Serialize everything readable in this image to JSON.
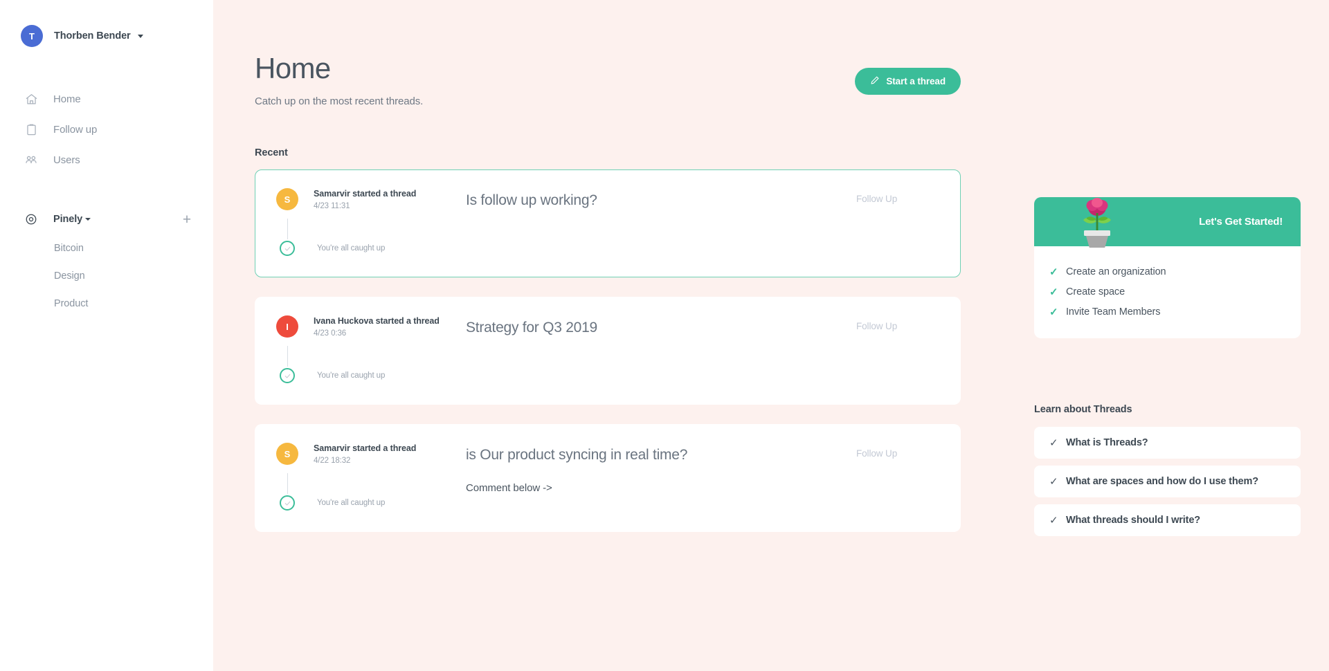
{
  "sidebar": {
    "user": {
      "initial": "T",
      "name": "Thorben Bender",
      "avatar_color": "#4A6CD4"
    },
    "nav_items": [
      {
        "label": "Home",
        "icon": "home-icon"
      },
      {
        "label": "Follow up",
        "icon": "clipboard-icon"
      },
      {
        "label": "Users",
        "icon": "users-icon"
      }
    ],
    "space": {
      "name": "Pinely",
      "icon": "target-icon",
      "add_label": "+"
    },
    "channels": [
      {
        "label": "Bitcoin"
      },
      {
        "label": "Design"
      },
      {
        "label": "Product"
      }
    ]
  },
  "header": {
    "title": "Home",
    "subtitle": "Catch up on the most recent threads.",
    "start_thread_label": "Start a thread"
  },
  "main": {
    "section_label": "Recent",
    "follow_up_label": "Follow Up",
    "caught_up_label": "You're all caught up",
    "threads": [
      {
        "initial": "S",
        "avatar_color": "#F6B83F",
        "author": "Samarvir started a thread",
        "time": "4/23 11:31",
        "title": "Is follow up working?",
        "snippet": "",
        "highlighted": true
      },
      {
        "initial": "I",
        "avatar_color": "#EE4B3C",
        "author": "Ivana Huckova started a thread",
        "time": "4/23 0:36",
        "title": "Strategy for Q3 2019",
        "snippet": "",
        "highlighted": false
      },
      {
        "initial": "S",
        "avatar_color": "#F6B83F",
        "author": "Samarvir started a thread",
        "time": "4/22 18:32",
        "title": "is Our product syncing in real time?",
        "snippet": "Comment below ->",
        "highlighted": false
      }
    ]
  },
  "rail": {
    "get_started": {
      "title": "Let's Get Started!",
      "accent_color": "#3BBD99",
      "icon": "potted-plant-icon",
      "items": [
        {
          "label": "Create an organization"
        },
        {
          "label": "Create space"
        },
        {
          "label": "Invite Team Members"
        }
      ]
    },
    "learn": {
      "title": "Learn about Threads",
      "items": [
        {
          "label": "What is Threads?"
        },
        {
          "label": "What are spaces and how do I use them?"
        },
        {
          "label": "What threads should I write?"
        }
      ]
    }
  }
}
